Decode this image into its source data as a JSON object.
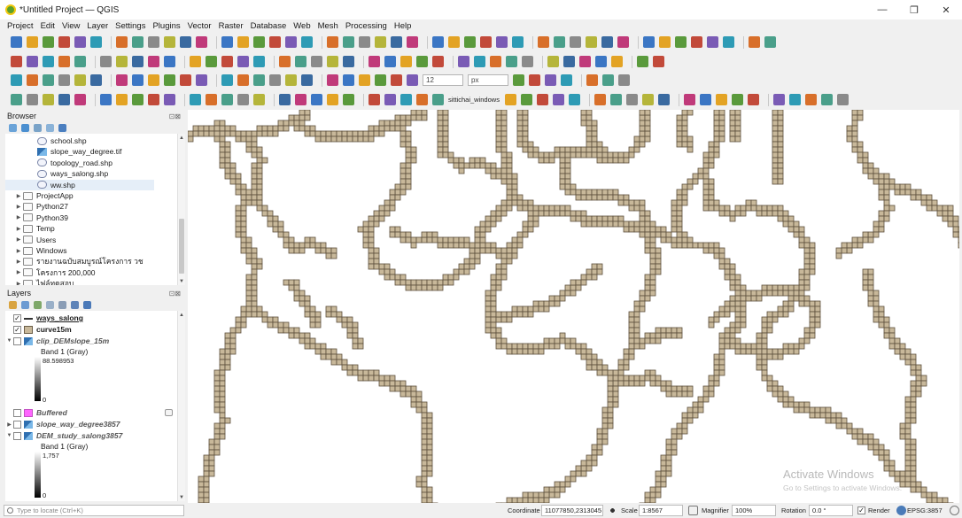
{
  "window": {
    "title": "*Untitled Project — QGIS",
    "min_icon": "—",
    "max_icon": "❐",
    "close_icon": "✕"
  },
  "menu": [
    "Project",
    "Edit",
    "View",
    "Layer",
    "Settings",
    "Plugins",
    "Vector",
    "Raster",
    "Database",
    "Web",
    "Mesh",
    "Processing",
    "Help"
  ],
  "toolbars": {
    "symbol_size": "12",
    "symbol_unit": "px",
    "user": "sittichai_windows"
  },
  "browser": {
    "title": "Browser",
    "items": [
      {
        "label": "school.shp",
        "icon": "vector-file-icon"
      },
      {
        "label": "slope_way_degree.tif",
        "icon": "raster-file-icon"
      },
      {
        "label": "topology_road.shp",
        "icon": "vector-file-icon"
      },
      {
        "label": "ways_salong.shp",
        "icon": "vector-file-icon"
      },
      {
        "label": "ww.shp",
        "icon": "vector-file-icon"
      },
      {
        "label": "ProjectApp",
        "icon": "folder-icon"
      },
      {
        "label": "Python27",
        "icon": "folder-icon"
      },
      {
        "label": "Python39",
        "icon": "folder-icon"
      },
      {
        "label": "Temp",
        "icon": "folder-icon"
      },
      {
        "label": "Users",
        "icon": "folder-icon"
      },
      {
        "label": "Windows",
        "icon": "folder-icon"
      },
      {
        "label": "รายงานฉบับสมบูรณ์โครงการ วช",
        "icon": "folder-icon"
      },
      {
        "label": "โครงการ 200,000",
        "icon": "folder-icon"
      },
      {
        "label": "ไฟล์ทดสอบ",
        "icon": "folder-icon"
      }
    ]
  },
  "layers": {
    "title": "Layers",
    "items": [
      {
        "name": "ways_salong",
        "checked": true,
        "symbol": "line"
      },
      {
        "name": "curve15m",
        "checked": true,
        "symbol": "polygon"
      },
      {
        "name": "clip_DEMslope_15m",
        "checked": false,
        "symbol": "raster",
        "band": "Band 1 (Gray)",
        "max": "88.598953",
        "min": "0"
      },
      {
        "name": "Buffered",
        "checked": false,
        "symbol": "pink-polygon"
      },
      {
        "name": "slope_way_degree3857",
        "checked": false,
        "symbol": "raster"
      },
      {
        "name": "DEM_study_salong3857",
        "checked": false,
        "symbol": "raster",
        "band": "Band 1 (Gray)",
        "max": "1,757",
        "min": "0"
      }
    ]
  },
  "status": {
    "locate_placeholder": "Type to locate (Ctrl+K)",
    "coordinate_label": "Coordinate",
    "coordinate": "11077850,2313045",
    "scale_label": "Scale",
    "scale": "1:8567",
    "magnifier_label": "Magnifier",
    "magnifier": "100%",
    "rotation_label": "Rotation",
    "rotation": "0.0 °",
    "render_label": "Render",
    "crs": "EPSG:3857"
  },
  "watermark": {
    "title": "Activate Windows",
    "subtitle": "Go to Settings to activate Windows."
  },
  "colors": {
    "road_cell_fill": "#c8b89a",
    "road_cell_stroke": "#5c4f3c",
    "selected_row": "#e5eef8"
  }
}
